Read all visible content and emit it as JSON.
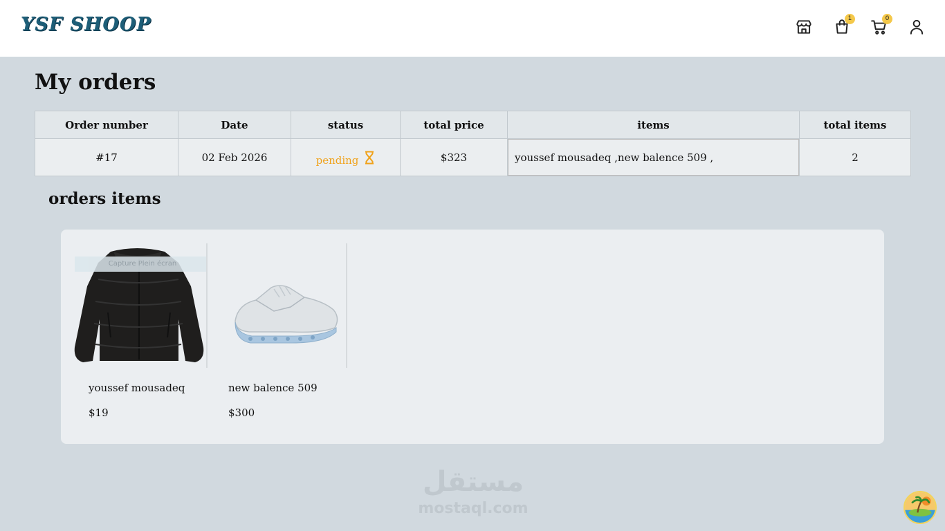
{
  "header": {
    "logo": "YSF SHOOP",
    "icons": [
      {
        "name": "store-icon"
      },
      {
        "name": "shopping-bag-icon",
        "badge": "1"
      },
      {
        "name": "cart-icon",
        "badge": "0"
      },
      {
        "name": "user-icon"
      }
    ]
  },
  "page": {
    "title": "My orders"
  },
  "orders_table": {
    "columns": [
      "Order number",
      "Date",
      "status",
      "total price",
      "items",
      "total items"
    ],
    "rows": [
      {
        "order_number": "#17",
        "date": "02 Feb 2026",
        "status": "pending",
        "total_price": "$323",
        "items": "youssef mousadeq ,new balence 509 ,",
        "total_items": "2"
      }
    ]
  },
  "order_items": {
    "title": "orders items",
    "items": [
      {
        "name": "youssef mousadeq",
        "price": "$19",
        "image": "black-puffer-jacket"
      },
      {
        "name": "new balence 509",
        "price": "$300",
        "image": "white-sneaker"
      }
    ]
  },
  "watermark": {
    "arabic": "مستقل",
    "latin": "mostaql.com"
  },
  "colors": {
    "brand": "#1d5e78",
    "pending": "#f0a21a",
    "badge": "#f4c84a",
    "background": "#d1d9df"
  }
}
